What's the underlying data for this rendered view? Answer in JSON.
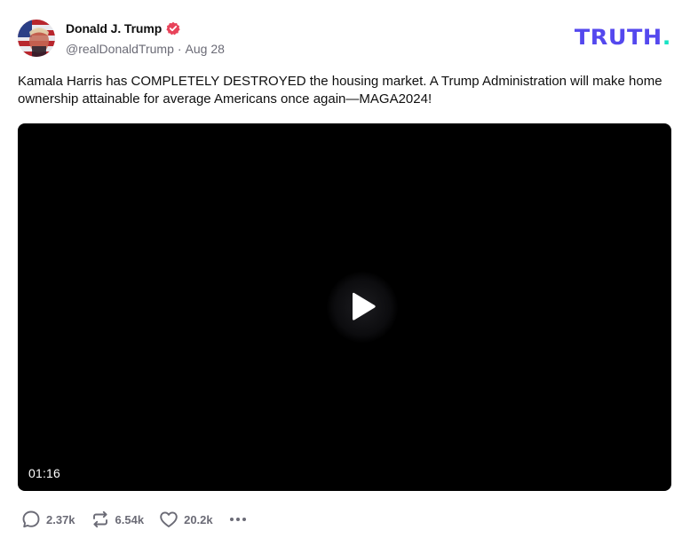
{
  "author": {
    "display_name": "Donald J. Trump",
    "handle": "@realDonaldTrump",
    "separator": "·",
    "date": "Aug 28",
    "verified_icon": "verified-badge-icon",
    "verified_color": "#e8435a"
  },
  "brand": {
    "logo_text": "TRUTH",
    "logo_dot": ".",
    "color": "#5448ee",
    "dot_color": "#17e3c4"
  },
  "post": {
    "text": "Kamala Harris has COMPLETELY DESTROYED the housing market. A Trump Administration will make home ownership attainable for average Americans once again—MAGA2024!"
  },
  "video": {
    "duration": "01:16",
    "play_icon": "play-icon"
  },
  "actions": {
    "replies": "2.37k",
    "reposts": "6.54k",
    "likes": "20.2k",
    "reply_icon": "comment-icon",
    "repost_icon": "repost-icon",
    "like_icon": "heart-icon",
    "more_icon": "more-horizontal-icon",
    "icon_color": "#6b6b76"
  }
}
